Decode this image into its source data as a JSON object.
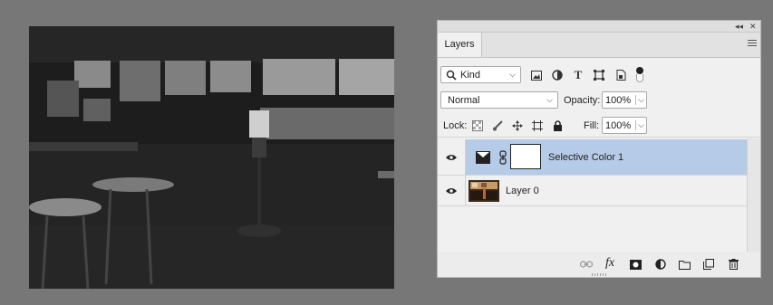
{
  "panel": {
    "collapse_glyph": "◂◂",
    "close_glyph": "✕",
    "tab_label": "Layers",
    "filter": {
      "kind_label": "Kind",
      "icons": [
        "image-filter-icon",
        "adjustment-filter-icon",
        "type-filter-icon",
        "shape-filter-icon",
        "smart-object-filter-icon",
        "filter-toggle-icon"
      ]
    },
    "blend_mode": "Normal",
    "opacity_label": "Opacity:",
    "opacity_value": "100%",
    "lock_label": "Lock:",
    "fill_label": "Fill:",
    "fill_value": "100%",
    "layers": [
      {
        "name": "Selective Color 1",
        "type": "adjustment",
        "visible": true,
        "selected": true
      },
      {
        "name": "Layer 0",
        "type": "image",
        "visible": true,
        "selected": false
      }
    ],
    "footer_icons": [
      "link-layers-icon",
      "fx-icon",
      "add-mask-icon",
      "new-fill-adjustment-icon",
      "new-group-icon",
      "new-layer-icon",
      "delete-layer-icon"
    ],
    "fx_label": "fx",
    "colors": {
      "selected_row": "#b5cbe8",
      "panel_bg": "#f0f0f0",
      "workspace": "#777777"
    }
  }
}
